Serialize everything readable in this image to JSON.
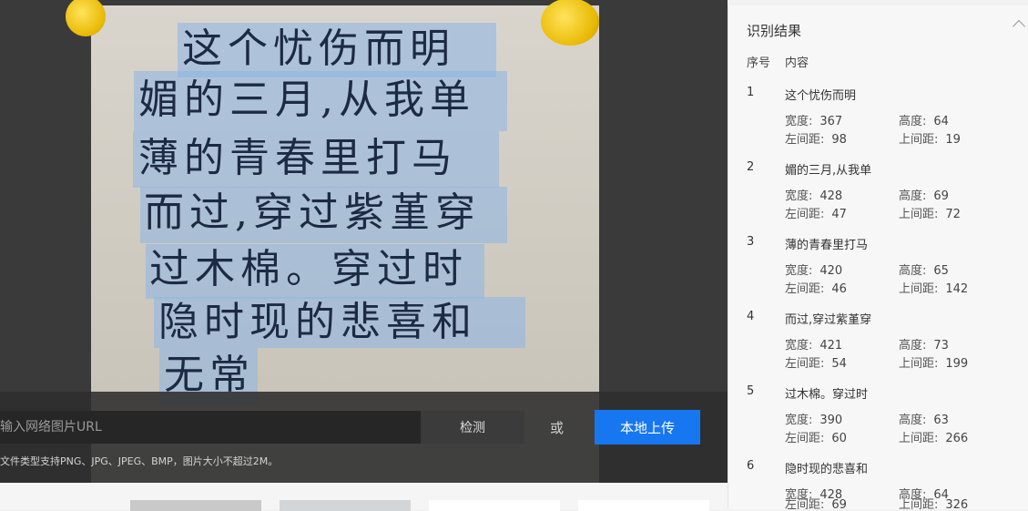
{
  "url_input": {
    "placeholder": "输入网络图片URL"
  },
  "buttons": {
    "detect": "检测",
    "or": "或",
    "upload": "本地上传"
  },
  "hint": "文件类型支持PNG、JPG、JPEG、BMP，图片大小不超过2M。",
  "handwriting_lines": [
    "这个忧伤而明",
    "媚的三月,从我单",
    "薄的青春里打马",
    "而过,穿过紫堇穿",
    "过木棉。穿过时",
    "隐时现的悲喜和",
    "无常"
  ],
  "results": {
    "title": "识别结果",
    "col_index": "序号",
    "col_content": "内容",
    "labels": {
      "width": "宽度:",
      "height": "高度:",
      "left": "左间距:",
      "top": "上间距:"
    },
    "items": [
      {
        "index": "1",
        "text": "这个忧伤而明",
        "width": "367",
        "height": "64",
        "left": "98",
        "top": "19"
      },
      {
        "index": "2",
        "text": "媚的三月,从我单",
        "width": "428",
        "height": "69",
        "left": "47",
        "top": "72"
      },
      {
        "index": "3",
        "text": "薄的青春里打马",
        "width": "420",
        "height": "65",
        "left": "46",
        "top": "142"
      },
      {
        "index": "4",
        "text": "而过,穿过紫堇穿",
        "width": "421",
        "height": "73",
        "left": "54",
        "top": "199"
      },
      {
        "index": "5",
        "text": "过木棉。穿过时",
        "width": "390",
        "height": "63",
        "left": "60",
        "top": "266"
      },
      {
        "index": "6",
        "text": "隐时现的悲喜和",
        "width": "428",
        "height": "64",
        "left": "69",
        "top": "326"
      }
    ]
  }
}
